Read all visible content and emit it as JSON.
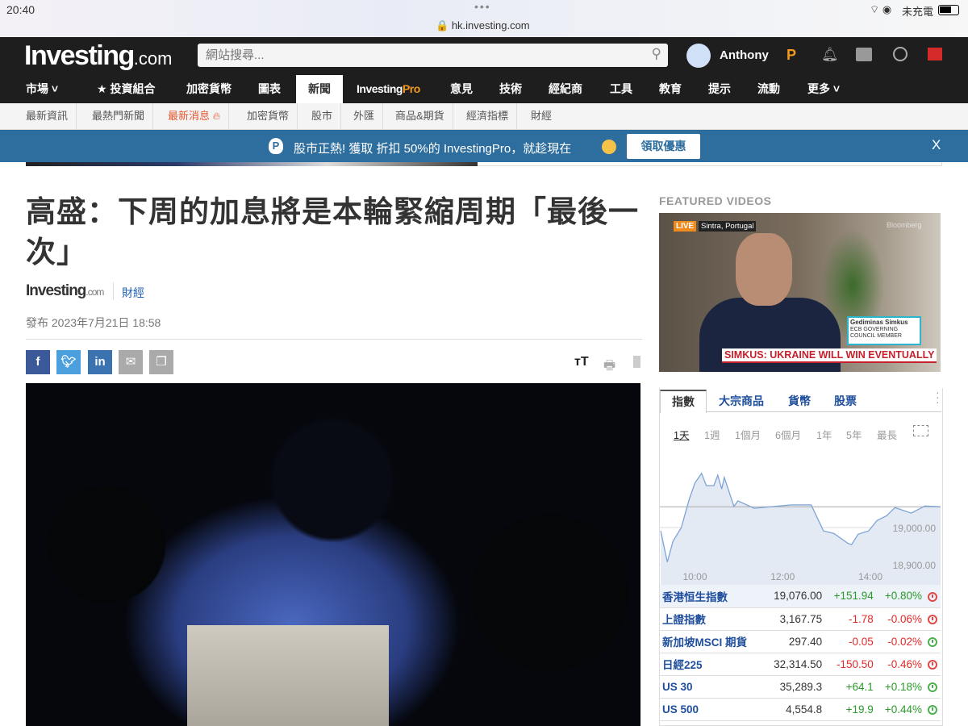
{
  "status": {
    "time": "20:40",
    "url": "hk.investing.com",
    "carrier": "未充電"
  },
  "header": {
    "logo": "Investing",
    "logo_suffix": ".com",
    "search_placeholder": "網站搜尋...",
    "user": "Anthony"
  },
  "nav": [
    "市場",
    "投資組合",
    "加密貨幣",
    "圖表",
    "新聞",
    "InvestingPro",
    "意見",
    "技術",
    "經紀商",
    "工具",
    "教育",
    "提示",
    "流動",
    "更多"
  ],
  "nav_pro": {
    "a": "Investing",
    "b": "Pro"
  },
  "subnav": [
    "最新資訊",
    "最熱門新聞",
    "最新消息",
    "加密貨幣",
    "股市",
    "外匯",
    "商品&期貨",
    "經濟指標",
    "財經"
  ],
  "promo": {
    "text": "股市正熱! 獲取 折扣 50%的 InvestingPro，就趁現在",
    "button": "領取優惠",
    "close": "X"
  },
  "article": {
    "title": "高盛：下周的加息將是本輪緊縮周期「最後一次」",
    "source": "Investing",
    "source_suffix": ".com",
    "category": "財經",
    "published": "發布 2023年7月21日 18:58"
  },
  "share": {
    "facebook": "f",
    "linkedin": "in",
    "font_size": "тT"
  },
  "videos": {
    "heading": "FEATURED VIDEOS",
    "live": "LIVE",
    "location": "Sintra, Portugal",
    "brand": "Bloomberg",
    "name": "Gediminas Simkus",
    "role1": "ECB GOVERNING",
    "role2": "COUNCIL MEMBER",
    "headline": "SIMKUS: UKRAINE WILL WIN EVENTUALLY"
  },
  "markets": {
    "tabs": [
      "指數",
      "大宗商品",
      "貨幣",
      "股票"
    ],
    "ranges": [
      "1天",
      "1週",
      "1個月",
      "6個月",
      "1年",
      "5年",
      "最長"
    ],
    "rows": [
      {
        "name": "香港恒生指數",
        "last": "19,076.00",
        "chg": "+151.94",
        "pct": "+0.80%",
        "open": false
      },
      {
        "name": "上證指數",
        "last": "3,167.75",
        "chg": "-1.78",
        "pct": "-0.06%",
        "open": false
      },
      {
        "name": "新加坡MSCI 期貨",
        "last": "297.40",
        "chg": "-0.05",
        "pct": "-0.02%",
        "open": true
      },
      {
        "name": "日經225",
        "last": "32,314.50",
        "chg": "-150.50",
        "pct": "-0.46%",
        "open": false
      },
      {
        "name": "US 30",
        "last": "35,289.3",
        "chg": "+64.1",
        "pct": "+0.18%",
        "open": true
      },
      {
        "name": "US 500",
        "last": "4,554.8",
        "chg": "+19.9",
        "pct": "+0.44%",
        "open": true
      }
    ]
  },
  "chart_data": {
    "type": "area",
    "title": "香港恒生指數 1天",
    "xlabel": "",
    "ylabel": "",
    "xticks": [
      {
        "v": 10,
        "label": "10:00"
      },
      {
        "v": 12,
        "label": "12:00"
      },
      {
        "v": 14,
        "label": "14:00"
      }
    ],
    "yticks": [
      {
        "v": 19000,
        "label": "19,000.00"
      },
      {
        "v": 18900,
        "label": "18,900.00"
      }
    ],
    "xlim": [
      9.2,
      15.6
    ],
    "ylim": [
      18850,
      19200
    ],
    "prev_close": 19056,
    "x": [
      9.22,
      9.37,
      9.5,
      9.69,
      9.87,
      10.0,
      10.15,
      10.26,
      10.43,
      10.52,
      10.61,
      10.67,
      10.89,
      10.98,
      11.35,
      12.19,
      12.65,
      12.93,
      13.17,
      13.48,
      13.57,
      13.72,
      13.96,
      14.15,
      14.37,
      14.56,
      14.93,
      15.24,
      15.57
    ],
    "y": [
      18991,
      18907,
      18963,
      19000,
      19076,
      19120,
      19146,
      19113,
      19113,
      19141,
      19104,
      19135,
      19057,
      19072,
      19052,
      19061,
      19061,
      18991,
      18984,
      18958,
      18954,
      18982,
      18991,
      19019,
      19032,
      19054,
      19039,
      19058,
      19056
    ]
  }
}
